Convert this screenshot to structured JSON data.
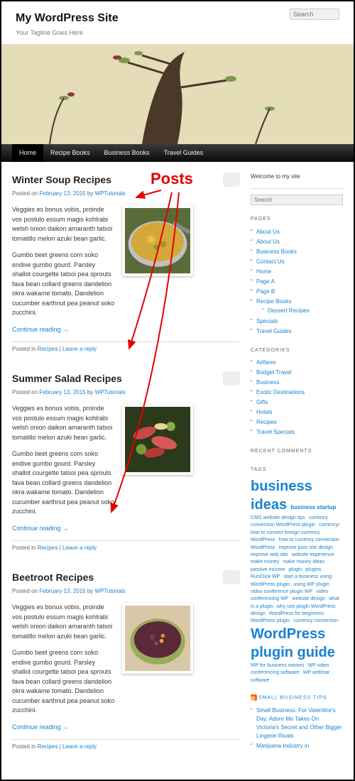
{
  "site": {
    "title": "My WordPress Site",
    "tagline": "Your Tagline Goes Here"
  },
  "search": {
    "placeholder": "Search"
  },
  "nav": [
    {
      "label": "Home",
      "current": true
    },
    {
      "label": "Recipe Books"
    },
    {
      "label": "Business Books"
    },
    {
      "label": "Travel Guides"
    }
  ],
  "annotation": {
    "label": "Posts"
  },
  "posts": [
    {
      "title": "Winter Soup Recipes",
      "posted_on": "Posted on ",
      "date": "February 13, 2015",
      "by": " by ",
      "author": "WPTutorials",
      "p1": "Veggies es bonus vobis, proinde vos postulo essum magis kohlrabi welsh onion daikon amaranth tatsoi tomatillo melon azuki bean garlic.",
      "p2": "Gumbo beet greens corn soko endive gumbo gourd. Parsley shallot courgette tatsoi pea sprouts fava bean collard greens dandelion okra wakame tomato. Dandelion cucumber earthnut pea peanut soko zucchini.",
      "more": "Continue reading →",
      "footer_prefix": "Posted in ",
      "footer_cat": "Recipes",
      "footer_sep": " | ",
      "footer_reply": "Leave a reply",
      "thumb": "soup"
    },
    {
      "title": "Summer Salad Recipes",
      "posted_on": "Posted on ",
      "date": "February 13, 2015",
      "by": " by ",
      "author": "WPTutorials",
      "p1": "Veggies es bonus vobis, proinde vos postulo essum magis kohlrabi welsh onion daikon amaranth tatsoi tomatillo melon azuki bean garlic.",
      "p2": "Gumbo beet greens corn soko endive gumbo gourd. Parsley shallot courgette tatsoi pea sprouts fava bean collard greens dandelion okra wakame tomato. Dandelion cucumber earthnut pea peanut soko zucchini.",
      "more": "Continue reading →",
      "footer_prefix": "Posted in ",
      "footer_cat": "Recipes",
      "footer_sep": " | ",
      "footer_reply": "Leave a reply",
      "thumb": "salad"
    },
    {
      "title": "Beetroot Recipes",
      "posted_on": "Posted on ",
      "date": "February 13, 2015",
      "by": " by ",
      "author": "WPTutorials",
      "p1": "Veggies es bonus vobis, proinde vos postulo essum magis kohlrabi welsh onion daikon amaranth tatsoi tomatillo melon azuki bean garlic.",
      "p2": "Gumbo beet greens corn soko endive gumbo gourd. Parsley shallot courgette tatsoi pea sprouts fava bean collard greens dandelion okra wakame tomato. Dandelion cucumber earthnut pea peanut soko zucchini.",
      "more": "Continue reading →",
      "footer_prefix": "Posted in ",
      "footer_cat": "Recipes",
      "footer_sep": " | ",
      "footer_reply": "Leave a reply",
      "thumb": "beetroot"
    }
  ],
  "sidebar": {
    "welcome": "Welcome to my site",
    "pages_title": "PAGES",
    "pages": [
      "About Us",
      "About Us",
      "Business Books",
      "Contact Us",
      "Home",
      "Page A",
      "Page B",
      "Recipe Books",
      "Specials",
      "Travel Guides"
    ],
    "pages_sub": {
      "parent_index": 7,
      "items": [
        "Dessert Recipes"
      ]
    },
    "categories_title": "CATEGORIES",
    "categories": [
      "Airfares",
      "Budget Travel",
      "Business",
      "Exotic Destinations",
      "Gifts",
      "Hotels",
      "Recipes",
      "Travel Specials"
    ],
    "recent_title": "RECENT COMMENTS",
    "tags_title": "TAGS",
    "tags": [
      {
        "t": "business ideas",
        "s": "xl"
      },
      {
        "t": "business startup",
        "s": "md"
      },
      {
        "t": "CMS website design tips",
        "s": "sm"
      },
      {
        "t": "currency conversion WordPress plugin",
        "s": "sm"
      },
      {
        "t": "currencyr",
        "s": "sm"
      },
      {
        "t": "how to convert foreign currency WordPress",
        "s": "sm"
      },
      {
        "t": "how to currency conversion WordPress",
        "s": "sm"
      },
      {
        "t": "improve poor site design",
        "s": "sm"
      },
      {
        "t": "improve web site",
        "s": "sm"
      },
      {
        "t": "website experience",
        "s": "sm"
      },
      {
        "t": "make money",
        "s": "sm"
      },
      {
        "t": "make money ideas",
        "s": "sm"
      },
      {
        "t": "passive income",
        "s": "sm"
      },
      {
        "t": "plugin",
        "s": "sm"
      },
      {
        "t": "plugins",
        "s": "sm"
      },
      {
        "t": "RunClick WP",
        "s": "sm"
      },
      {
        "t": "start a business using WordPress plugin",
        "s": "sm"
      },
      {
        "t": "using WP plugin",
        "s": "sm"
      },
      {
        "t": "video conference plugin WP",
        "s": "sm"
      },
      {
        "t": "video conferencing WP",
        "s": "sm"
      },
      {
        "t": "website design",
        "s": "sm"
      },
      {
        "t": "what is a plugin",
        "s": "sm"
      },
      {
        "t": "why use plugin WordPress design",
        "s": "sm"
      },
      {
        "t": "WordPress for beginners",
        "s": "sm"
      },
      {
        "t": "WordPress plugin",
        "s": "sm"
      },
      {
        "t": "currency conversion",
        "s": "sm"
      },
      {
        "t": "WordPress plugin guide",
        "s": "xl"
      },
      {
        "t": "WP for business owners",
        "s": "sm"
      },
      {
        "t": "WP video conferencing software",
        "s": "sm"
      },
      {
        "t": "WP webinar software",
        "s": "sm"
      }
    ],
    "rss_title": "SMALL BUSINESS TIPS",
    "rss": [
      "Small Business: For Valentine's Day, Adore Me Takes On Victoria's Secret and Other Bigger Lingerie Rivals",
      "Marijuana Industry in"
    ]
  }
}
